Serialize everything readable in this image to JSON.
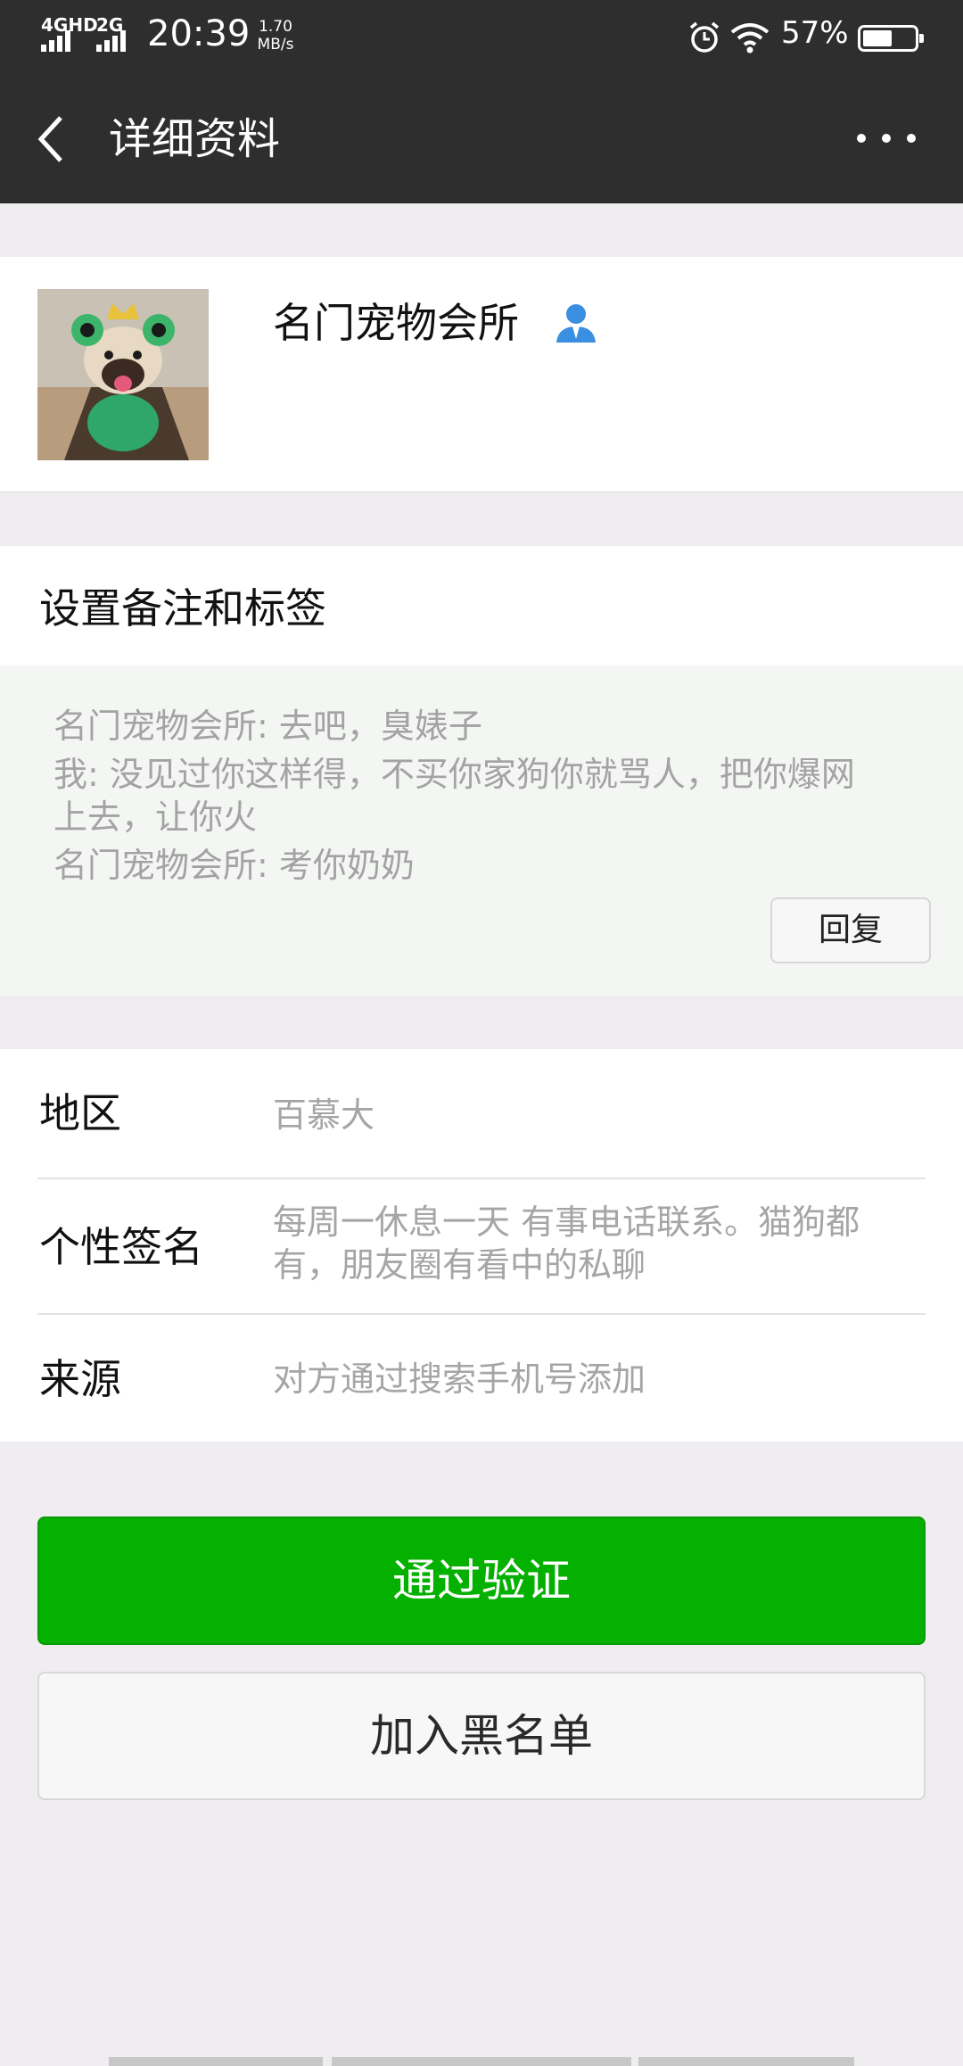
{
  "status_bar": {
    "network_1": "4GHD",
    "network_2": "2G",
    "time": "20:39",
    "speed_value": "1.70",
    "speed_unit": "MB/s",
    "battery": "57%",
    "battery_level": 0.57
  },
  "nav": {
    "title": "详细资料"
  },
  "profile": {
    "name": "名门宠物会所"
  },
  "remark": {
    "label": "设置备注和标签"
  },
  "moments": {
    "lines": [
      "名门宠物会所: 去吧，臭婊子",
      "我: 没见过你这样得，不买你家狗你就骂人，把你爆网",
      "上去，让你火",
      "名门宠物会所: 考你奶奶"
    ],
    "reply_label": "回复"
  },
  "info": {
    "region_label": "地区",
    "region_value": "百慕大",
    "signature_label": "个性签名",
    "signature_line1": "每周一休息一天 有事电话联系。猫狗都",
    "signature_line2": "有，朋友圈有看中的私聊",
    "source_label": "来源",
    "source_value": "对方通过搜索手机号添加"
  },
  "actions": {
    "accept_label": "通过验证",
    "block_label": "加入黑名单"
  },
  "colors": {
    "header": "#2e2e2e",
    "accent_green": "#04b000",
    "page_bg": "#efedf0",
    "contact_icon": "#3b8fe0"
  }
}
